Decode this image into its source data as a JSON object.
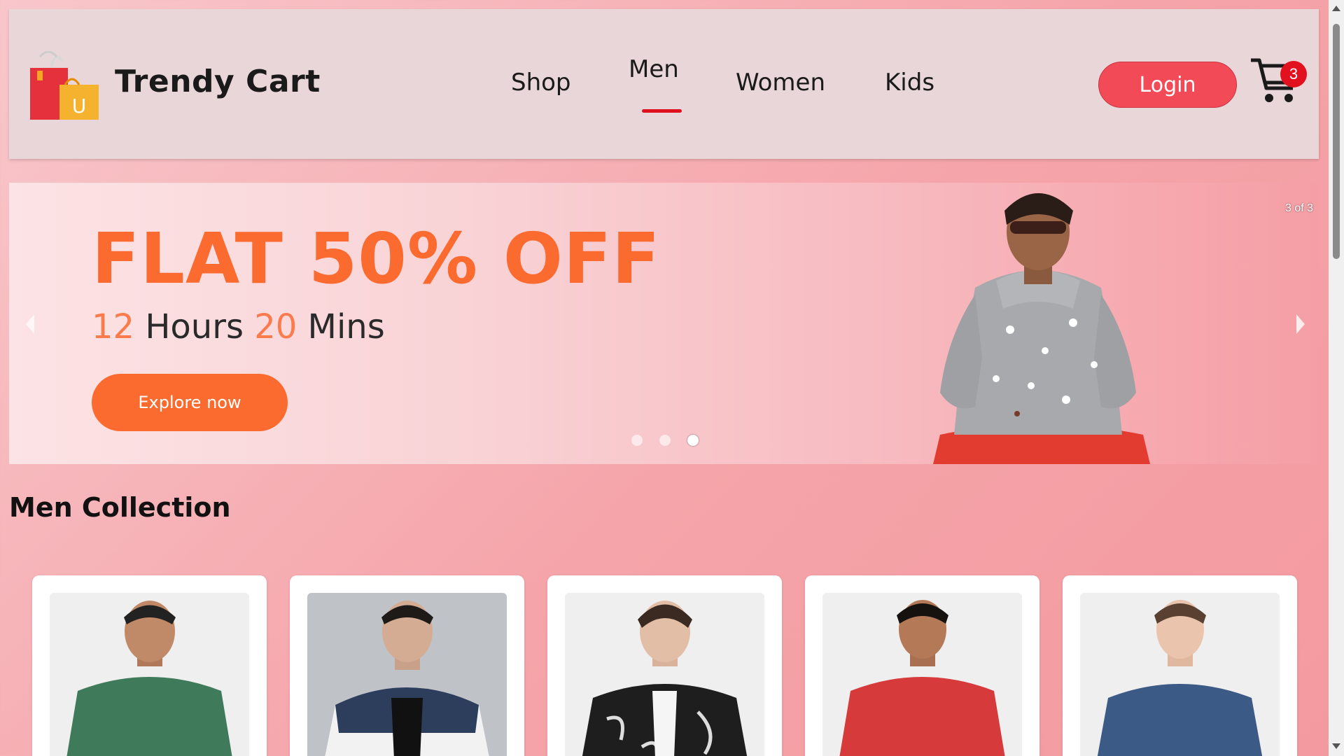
{
  "header": {
    "brand": "Trendy Cart",
    "nav": [
      {
        "label": "Shop"
      },
      {
        "label": "Men"
      },
      {
        "label": "Women"
      },
      {
        "label": "Kids"
      }
    ],
    "active_nav": "Men",
    "login_label": "Login",
    "cart_count": "3",
    "logo_letter": "U"
  },
  "banner": {
    "title": "FLAT 50% OFF",
    "hours": "12",
    "hours_unit": " Hours ",
    "mins": "20",
    "mins_unit": " Mins",
    "cta": "Explore now",
    "slide_counter": "3 of 3",
    "active_slide": 3,
    "total_slides": 3
  },
  "section": {
    "title": "Men Collection"
  },
  "products": [
    {
      "name": "green hooded jacket",
      "color": "#3f7a5a"
    },
    {
      "name": "white navy puffer jacket",
      "color": "#e8e8ea"
    },
    {
      "name": "black marble print bomber",
      "color": "#1e1e1e"
    },
    {
      "name": "red hooded jacket",
      "color": "#d63a3a"
    },
    {
      "name": "denim jacket",
      "color": "#3b5a85"
    }
  ],
  "colors": {
    "accent": "#f24a57",
    "promo": "#fb6a2e",
    "underline": "#e0111f"
  }
}
